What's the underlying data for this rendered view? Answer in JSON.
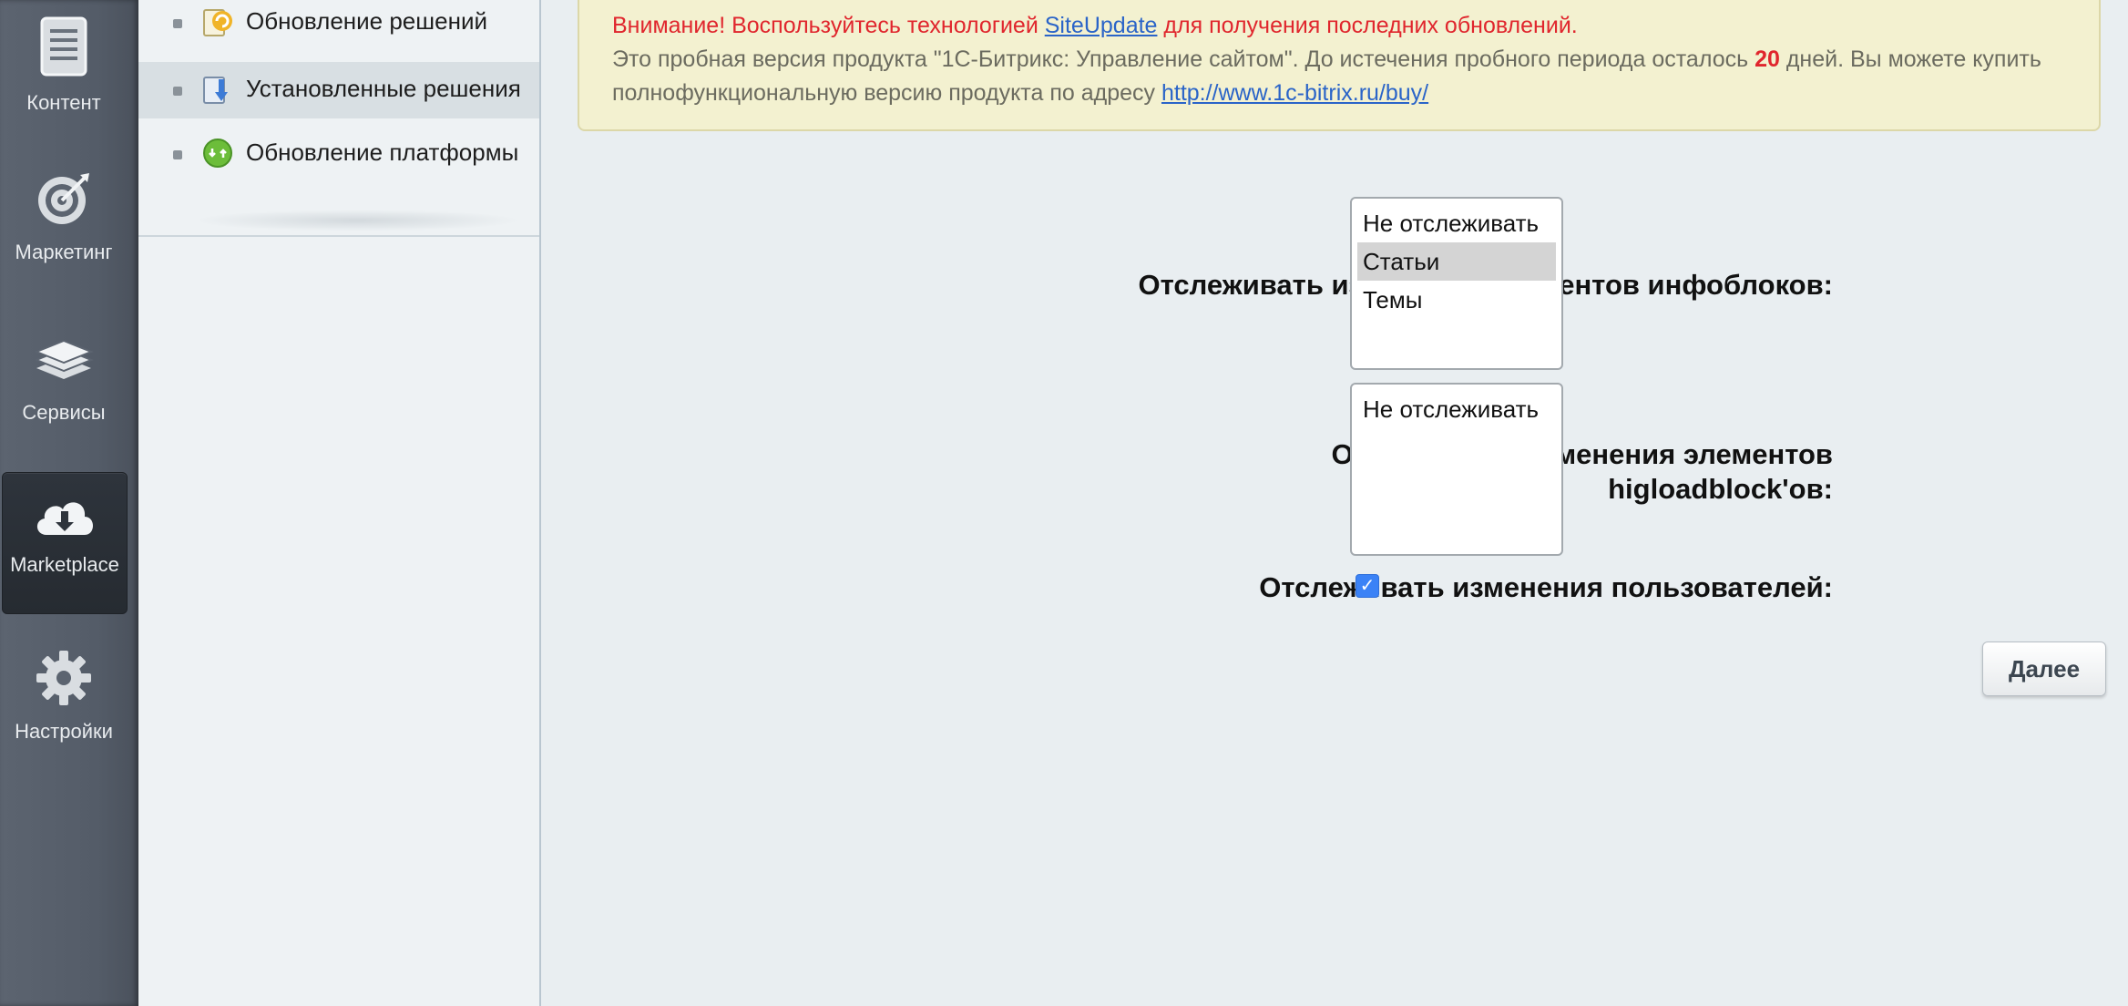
{
  "left_panel": {
    "items": [
      {
        "label": "Контент",
        "icon": "document-icon"
      },
      {
        "label": "Маркетинг",
        "icon": "target-icon"
      },
      {
        "label": "Сервисы",
        "icon": "layers-icon"
      },
      {
        "label": "Marketplace",
        "icon": "cloud-download-icon",
        "active": true
      },
      {
        "label": "Настройки",
        "icon": "gear-icon"
      }
    ]
  },
  "submenu": {
    "items": [
      {
        "label": "Обновление решений",
        "icon": "update-solutions-icon"
      },
      {
        "label": "Установленные решения",
        "icon": "installed-solutions-icon",
        "active": true
      },
      {
        "label": "Обновление платформы",
        "icon": "platform-update-icon"
      }
    ]
  },
  "notice": {
    "warning_prefix": "Внимание! Воспользуйтесь технологией",
    "siteupdate_link": "SiteUpdate",
    "warning_suffix": "для получения последних обновлений.",
    "trial_text_1": "Это пробная версия продукта \"1С-Битрикс: Управление сайтом\". До истечения пробного периода осталось",
    "days_left": "20",
    "trial_text_2": "дней. Вы можете купить полнофункциональную версию продукта по адресу",
    "buy_link": "http://www.1c-bitrix.ru/buy/"
  },
  "form": {
    "iblock_label": "Отслеживать изменения элементов инфоблоков:",
    "iblock_options": [
      "Не отслеживать",
      "Статьи",
      "Темы"
    ],
    "iblock_selected": "Статьи",
    "highload_label": "Отслеживать изменения элементов higloadblock'ов:",
    "highload_options": [
      "Не отслеживать"
    ],
    "users_label": "Отслеживать изменения пользователей:",
    "users_checked": true,
    "next_button": "Далее"
  },
  "colors": {
    "accent_red": "#e0262d",
    "link_blue": "#2a64c8",
    "notice_bg": "#f3f1d0",
    "checkbox_blue": "#3b82f6"
  }
}
